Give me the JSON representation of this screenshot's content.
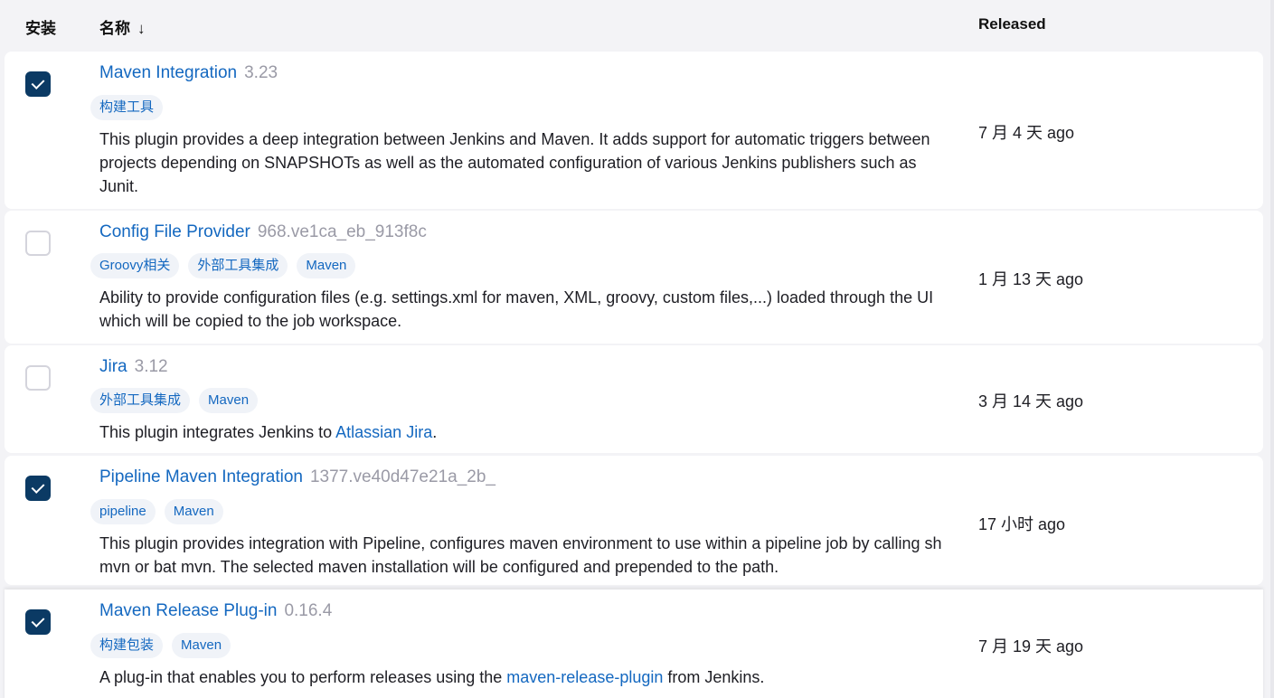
{
  "header": {
    "install": "安装",
    "name": "名称",
    "sort_arrow": "↓",
    "released": "Released"
  },
  "plugins": [
    {
      "name": "Maven Integration",
      "version": "3.23",
      "checked": true,
      "tags": [
        "构建工具"
      ],
      "description": "This plugin provides a deep integration between Jenkins and Maven. It adds support for automatic triggers between projects depending on SNAPSHOTs as well as the automated configuration of various Jenkins publishers such as Junit.",
      "released": "7 月 4 天 ago"
    },
    {
      "name": "Config File Provider",
      "version": "968.ve1ca_eb_913f8c",
      "checked": false,
      "tags": [
        "Groovy相关",
        "外部工具集成",
        "Maven"
      ],
      "description": "Ability to provide configuration files (e.g. settings.xml for maven, XML, groovy, custom files,...) loaded through the UI which will be copied to the job workspace.",
      "released": "1 月 13 天 ago"
    },
    {
      "name": "Jira",
      "version": "3.12",
      "checked": false,
      "tags": [
        "外部工具集成",
        "Maven"
      ],
      "description_before": "This plugin integrates Jenkins to ",
      "description_link": "Atlassian Jira",
      "description_after": ".",
      "released": "3 月 14 天 ago"
    },
    {
      "name": "Pipeline Maven Integration",
      "version": "1377.ve40d47e21a_2b_",
      "checked": true,
      "tags": [
        "pipeline",
        "Maven"
      ],
      "description": "This plugin provides integration with Pipeline, configures maven environment to use within a pipeline job by calling sh mvn or bat mvn. The selected maven installation will be configured and prepended to the path.",
      "released": "17 小时 ago"
    },
    {
      "name": "Maven Release Plug-in",
      "version": "0.16.4",
      "checked": true,
      "tags": [
        "构建包装",
        "Maven"
      ],
      "description_before": "A plug-in that enables you to perform releases using the ",
      "description_link": "maven-release-plugin",
      "description_after": " from Jenkins.",
      "released": "7 月 19 天 ago"
    }
  ]
}
